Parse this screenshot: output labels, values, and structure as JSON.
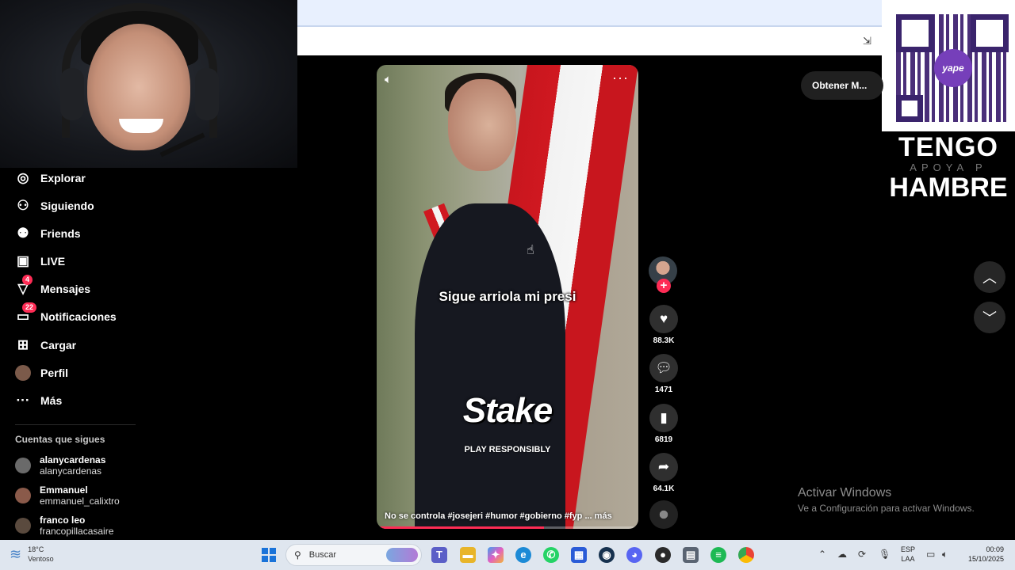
{
  "overlay": {
    "qr_brand": "yape",
    "hungry_line1": "TENGO",
    "hungry_line2": "APOYA P",
    "hungry_line3": "HAMBRE"
  },
  "nav": {
    "items": [
      {
        "label": "Explorar",
        "icon": "compass-icon"
      },
      {
        "label": "Siguiendo",
        "icon": "user-follow-icon"
      },
      {
        "label": "Friends",
        "icon": "friends-icon"
      },
      {
        "label": "LIVE",
        "icon": "live-tv-icon"
      },
      {
        "label": "Mensajes",
        "icon": "send-icon",
        "badge": "4"
      },
      {
        "label": "Notificaciones",
        "icon": "inbox-icon",
        "badge": "22"
      },
      {
        "label": "Cargar",
        "icon": "plus-box-icon"
      },
      {
        "label": "Perfil",
        "icon": "avatar-icon"
      },
      {
        "label": "Más",
        "icon": "more-dots-icon"
      }
    ]
  },
  "following": {
    "heading": "Cuentas que sigues",
    "accounts": [
      {
        "name": "alanycardenas",
        "handle": "alanycardenas"
      },
      {
        "name": "Emmanuel",
        "handle": "emmanuel_calixtro"
      },
      {
        "name": "franco leo",
        "handle": "francopillacasaire"
      }
    ]
  },
  "video": {
    "caption": "Sigue arriola mi presi",
    "sponsor": "Stake",
    "sponsor_sub": "PLAY RESPONSIBLY",
    "description": "No se controla #josejeri  #humor  #gobierno  #fyp  ...  más",
    "progress": 0.64,
    "more": "···"
  },
  "actions": {
    "likes": "88.3K",
    "comments": "1471",
    "saves": "6819",
    "shares": "64.1K"
  },
  "right": {
    "get_app": "Obtener M...",
    "activate_title": "Activar Windows",
    "activate_sub": "Ve a Configuración para activar Windows."
  },
  "taskbar": {
    "temp": "18°C",
    "weather": "Ventoso",
    "search_placeholder": "Buscar",
    "lang1": "ESP",
    "lang2": "LAA",
    "time": "00:09",
    "date": "15/10/2025"
  },
  "colors": {
    "accent": "#fe2c55",
    "taskbar": "#dfe6ef"
  }
}
